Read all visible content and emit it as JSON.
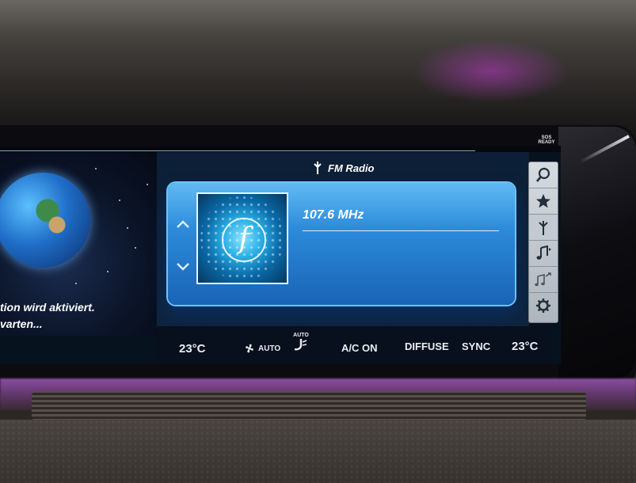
{
  "status": {
    "sos_line1": "SOS",
    "sos_line2": "READY"
  },
  "left_panel": {
    "activation_text": "tion wird aktiviert.\nvarten..."
  },
  "header": {
    "source_title": "FM Radio",
    "source_icon": "antenna-icon"
  },
  "radio_card": {
    "frequency": "107.6 MHz",
    "up_arrow": "^",
    "down_arrow": "v",
    "art_letter": "f"
  },
  "toolbar": {
    "items": [
      {
        "name": "search",
        "icon": "search-icon"
      },
      {
        "name": "favorites",
        "icon": "star-icon"
      },
      {
        "name": "source",
        "icon": "antenna-icon"
      },
      {
        "name": "media",
        "icon": "music-note-icon"
      },
      {
        "name": "sound",
        "icon": "music-arrow-icon"
      },
      {
        "name": "settings",
        "icon": "gear-icon"
      }
    ]
  },
  "climate": {
    "left_temp": "23°C",
    "fan": "AUTO",
    "airflow": "AUTO",
    "ac": "A/C ON",
    "diffuse": "DIFFUSE",
    "sync": "SYNC",
    "right_temp": "23°C"
  },
  "colors": {
    "card_top": "#3fa9f0",
    "card_bottom": "#1a63b6",
    "card_border": "#6ec3ff",
    "ambient_light": "#8a4fa0"
  }
}
